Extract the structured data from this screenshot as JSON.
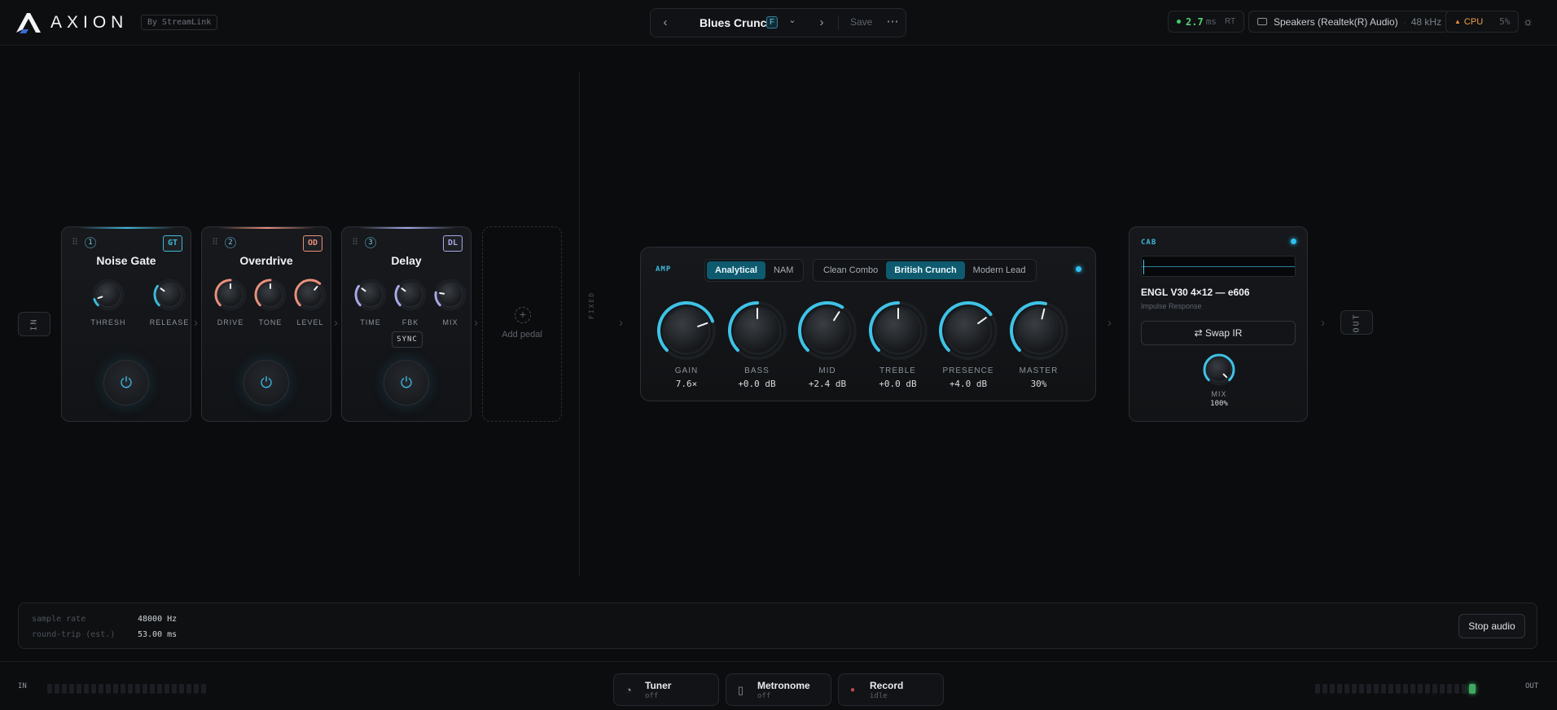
{
  "app": {
    "name": "AXION",
    "byline": "By StreamLink"
  },
  "preset": {
    "name": "Blues Crunch",
    "key": "F",
    "save_label": "Save"
  },
  "status": {
    "latency_value": "2.7",
    "latency_unit": "ms",
    "latency_mode": "RT",
    "device": "Speakers (Realtek(R) Audio)",
    "sample_rate": "48 kHz",
    "cpu_label": "CPU",
    "cpu_value": "5%"
  },
  "chain": {
    "in_label": "IN",
    "out_label": "OUT",
    "fixed_label": "FIXED",
    "add_pedal_label": "Add pedal",
    "pedals": [
      {
        "index": "1",
        "title": "Noise Gate",
        "tag": "GT",
        "accent": "#3fb8d8",
        "knobs": [
          {
            "label": "THRESH",
            "level": 0.1
          },
          {
            "label": "RELEASE",
            "level": 0.3
          }
        ]
      },
      {
        "index": "2",
        "title": "Overdrive",
        "tag": "OD",
        "accent": "#e8907a",
        "knobs": [
          {
            "label": "DRIVE",
            "level": 0.5
          },
          {
            "label": "TONE",
            "level": 0.5
          },
          {
            "label": "LEVEL",
            "level": 0.65
          }
        ]
      },
      {
        "index": "3",
        "title": "Delay",
        "tag": "DL",
        "accent": "#a8a8e8",
        "knobs": [
          {
            "label": "TIME",
            "level": 0.3
          },
          {
            "label": "FBK",
            "level": 0.3
          },
          {
            "label": "MIX",
            "level": 0.2
          }
        ],
        "extra_button": "SYNC"
      }
    ]
  },
  "amp": {
    "label": "AMP",
    "modes": [
      "Analytical",
      "NAM"
    ],
    "active_mode": "Analytical",
    "models": [
      "Clean Combo",
      "British Crunch",
      "Modern Lead"
    ],
    "active_model": "British Crunch",
    "knobs": [
      {
        "label": "GAIN",
        "value": "7.6×",
        "level": 0.76
      },
      {
        "label": "BASS",
        "value": "+0.0 dB",
        "level": 0.5
      },
      {
        "label": "MID",
        "value": "+2.4 dB",
        "level": 0.62
      },
      {
        "label": "TREBLE",
        "value": "+0.0 dB",
        "level": 0.5
      },
      {
        "label": "PRESENCE",
        "value": "+4.0 dB",
        "level": 0.7
      },
      {
        "label": "MASTER",
        "value": "30%",
        "level": 0.55
      }
    ]
  },
  "cab": {
    "label": "CAB",
    "ir_name": "ENGL V30 4×12 — e606",
    "ir_sub": "Impulse Response",
    "swap_label": "Swap IR",
    "mix_label": "MIX",
    "mix_value": "100%",
    "mix_level": 1.0
  },
  "info": {
    "rows": [
      {
        "k": "sample rate",
        "v": "48000 Hz"
      },
      {
        "k": "round-trip (est.)",
        "v": "53.00 ms"
      }
    ],
    "stop_label": "Stop audio"
  },
  "footer": {
    "in_label": "IN",
    "out_label": "OUT",
    "tools": [
      {
        "label": "Tuner",
        "sub": "off"
      },
      {
        "label": "Metronome",
        "sub": "off"
      },
      {
        "label": "Record",
        "sub": "idle"
      }
    ]
  }
}
